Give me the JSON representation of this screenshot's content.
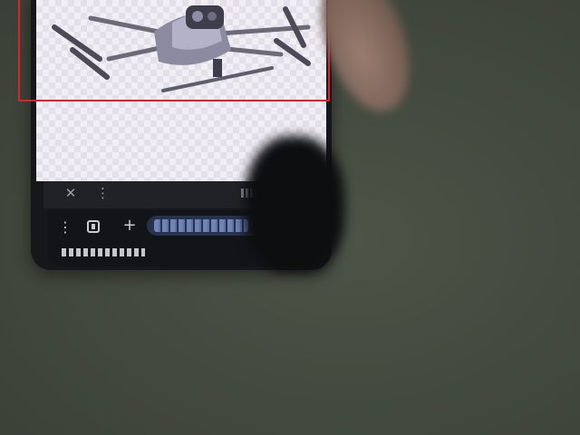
{
  "scene": {
    "subject": "drone-icon",
    "icons": {
      "close": "close-icon",
      "more": "kebab-icon",
      "menu": "menu-icon",
      "tabs": "tabs-icon",
      "new_tab": "plus-icon"
    },
    "colors": {
      "highlight": "#e0212a",
      "background": "#434a3f",
      "url_bar": "#27324f"
    }
  }
}
